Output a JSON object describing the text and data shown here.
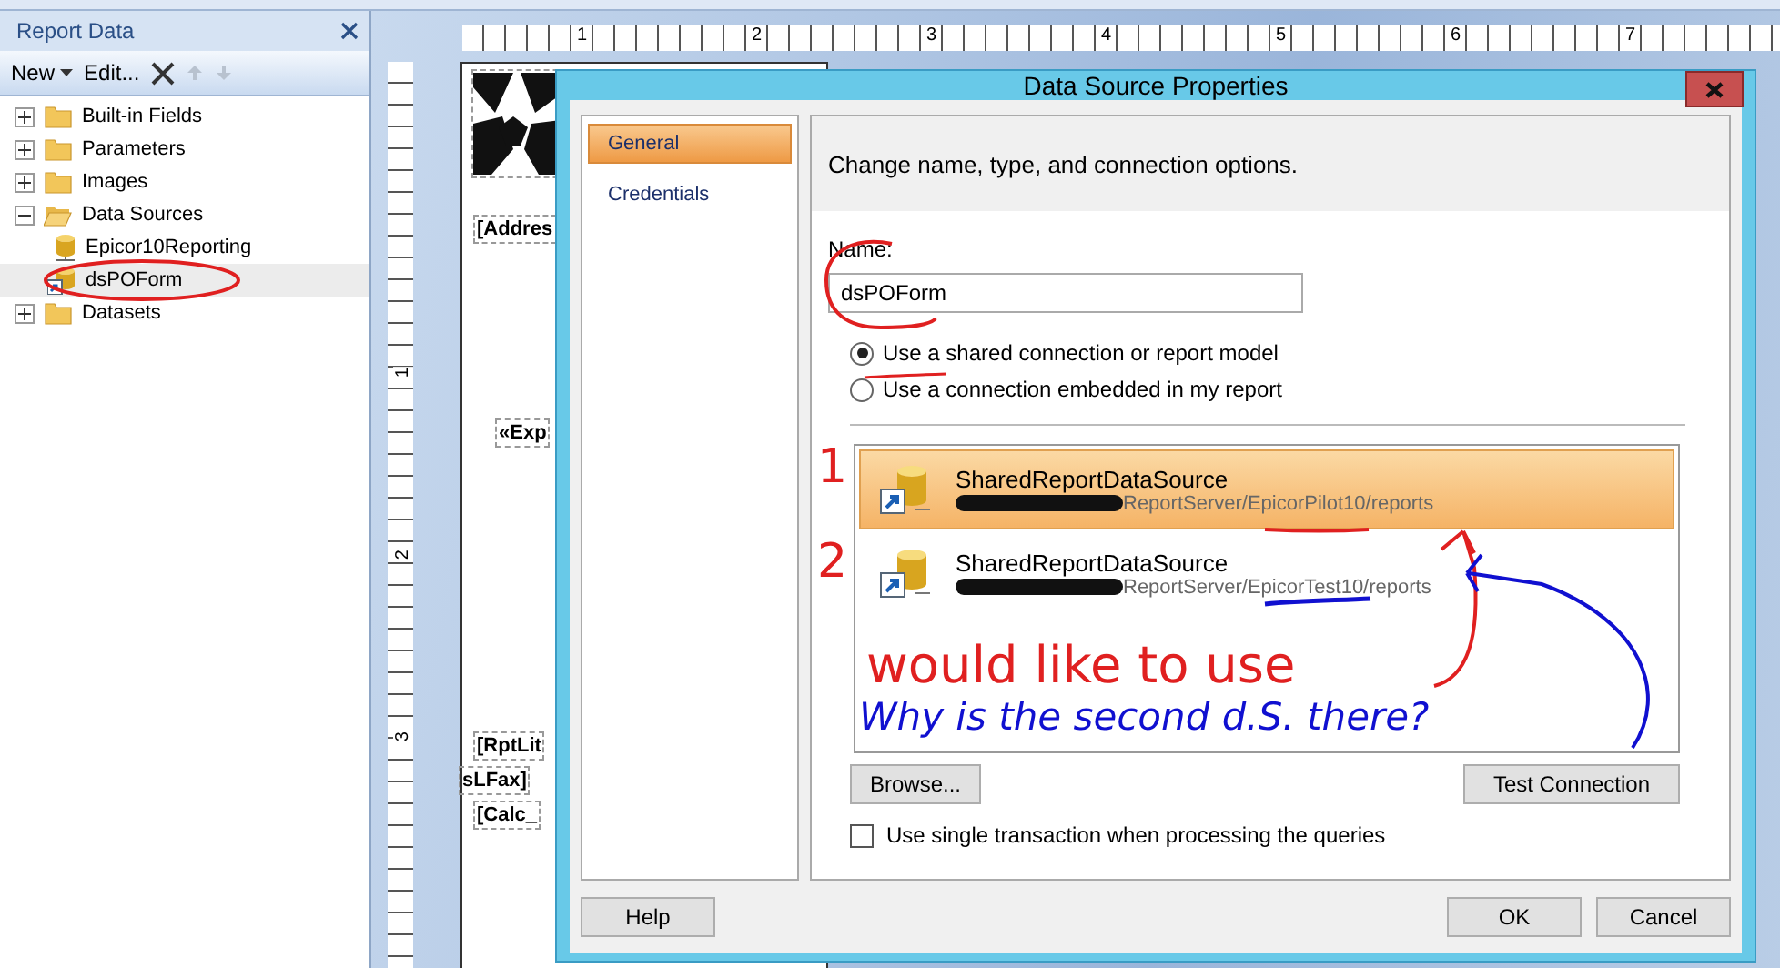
{
  "report_data": {
    "title": "Report Data",
    "new_label": "New",
    "edit_label": "Edit...",
    "tree": [
      {
        "label": "Built-in Fields",
        "kind": "folder",
        "expanded": false
      },
      {
        "label": "Parameters",
        "kind": "folder",
        "expanded": false
      },
      {
        "label": "Images",
        "kind": "folder",
        "expanded": false
      },
      {
        "label": "Data Sources",
        "kind": "folder",
        "expanded": true,
        "children": [
          {
            "label": "Epicor10Reporting",
            "kind": "datasource",
            "selected": false
          },
          {
            "label": "dsPOForm",
            "kind": "shared-datasource",
            "selected": true
          }
        ]
      },
      {
        "label": "Datasets",
        "kind": "folder",
        "expanded": false
      }
    ]
  },
  "ruler": {
    "marks": [
      "1",
      "2",
      "3",
      "4",
      "5",
      "6",
      "7"
    ],
    "vertical_marks": [
      "1",
      "2",
      "3"
    ]
  },
  "report_fields": [
    "[Addres",
    "«Exp",
    "[RptLit",
    "sLFax]",
    "[Calc_"
  ],
  "dialog": {
    "title": "Data Source Properties",
    "pages": [
      {
        "label": "General",
        "selected": true
      },
      {
        "label": "Credentials",
        "selected": false
      }
    ],
    "heading": "Change name, type, and connection options.",
    "name_label": "Name:",
    "name_value": "dsPOForm",
    "options": [
      {
        "label": "Use a shared connection or report model",
        "selected": true
      },
      {
        "label": "Use a connection embedded in my report",
        "selected": false
      }
    ],
    "data_sources": [
      {
        "name": "SharedReportDataSource",
        "path": "ReportServer/EpicorPilot10/reports",
        "selected": true
      },
      {
        "name": "SharedReportDataSource",
        "path": "ReportServer/EpicorTest10/reports",
        "selected": false
      }
    ],
    "browse": "Browse...",
    "test": "Test Connection",
    "single_transaction": {
      "label": "Use single transaction when processing the queries",
      "checked": false
    },
    "help": "Help",
    "ok": "OK",
    "cancel": "Cancel"
  },
  "annotations": [
    {
      "text": "1",
      "color": "#e02020"
    },
    {
      "text": "2",
      "color": "#e02020"
    },
    {
      "text": "would like to use",
      "color": "#e02020"
    },
    {
      "text": "Why is the second d.S. there?",
      "color": "#1010d0"
    }
  ]
}
